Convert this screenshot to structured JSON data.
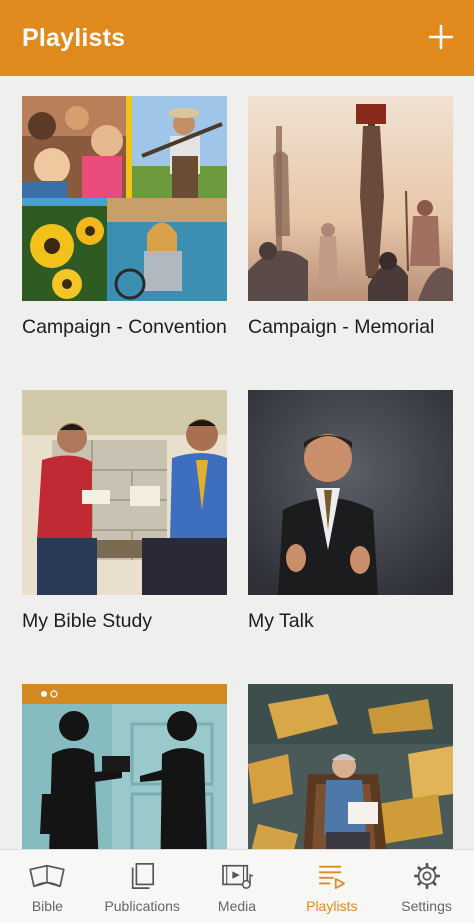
{
  "appbar": {
    "title": "Playlists",
    "add_icon": "plus-icon",
    "color": "#e08a1e"
  },
  "playlists": [
    {
      "title": "Campaign - Convention"
    },
    {
      "title": "Campaign - Memorial"
    },
    {
      "title": "My Bible Study"
    },
    {
      "title": "My Talk"
    },
    {
      "title": "",
      "thumb_indicator": "dots"
    },
    {
      "title": ""
    }
  ],
  "tabs": [
    {
      "label": "Bible",
      "icon": "open-book-icon",
      "active": false
    },
    {
      "label": "Publications",
      "icon": "stacked-pages-icon",
      "active": false
    },
    {
      "label": "Media",
      "icon": "media-icon",
      "active": false
    },
    {
      "label": "Playlists",
      "icon": "playlist-icon",
      "active": true
    },
    {
      "label": "Settings",
      "icon": "gear-icon",
      "active": false
    }
  ],
  "colors": {
    "accent": "#e08a1e",
    "background": "#efefed",
    "tab_inactive": "#666666"
  }
}
